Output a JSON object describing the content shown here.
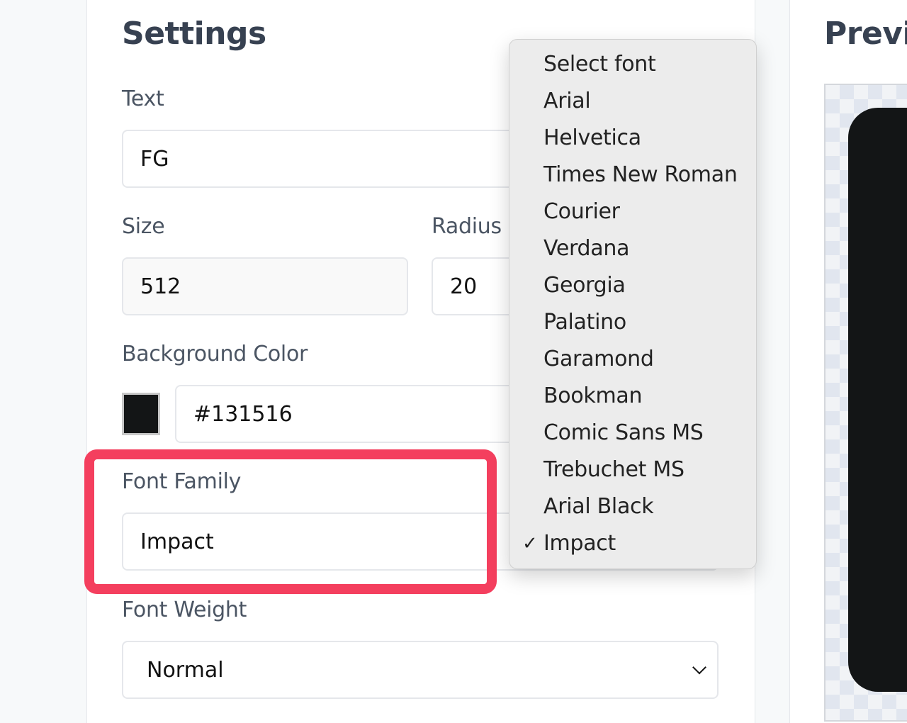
{
  "settings": {
    "title": "Settings",
    "text_label": "Text",
    "text_value": "FG",
    "size_label": "Size",
    "size_value": "512",
    "radius_label": "Radius",
    "radius_value": "20",
    "bg_color_label": "Background Color",
    "bg_color_value": "#131516",
    "bg_color_swatch": "#131516",
    "font_family_label": "Font Family",
    "font_family_value": "Impact",
    "font_weight_label": "Font Weight",
    "font_weight_value": "Normal"
  },
  "font_dropdown": {
    "selected": "Impact",
    "check_glyph": "✓",
    "options": [
      "Select font",
      "Arial",
      "Helvetica",
      "Times New Roman",
      "Courier",
      "Verdana",
      "Georgia",
      "Palatino",
      "Garamond",
      "Bookman",
      "Comic Sans MS",
      "Trebuchet MS",
      "Arial Black",
      "Impact"
    ]
  },
  "preview": {
    "title": "Previ",
    "icon_color": "#131516"
  },
  "colors": {
    "highlight": "#f43f5e",
    "heading": "#374151",
    "label": "#4b5563"
  }
}
